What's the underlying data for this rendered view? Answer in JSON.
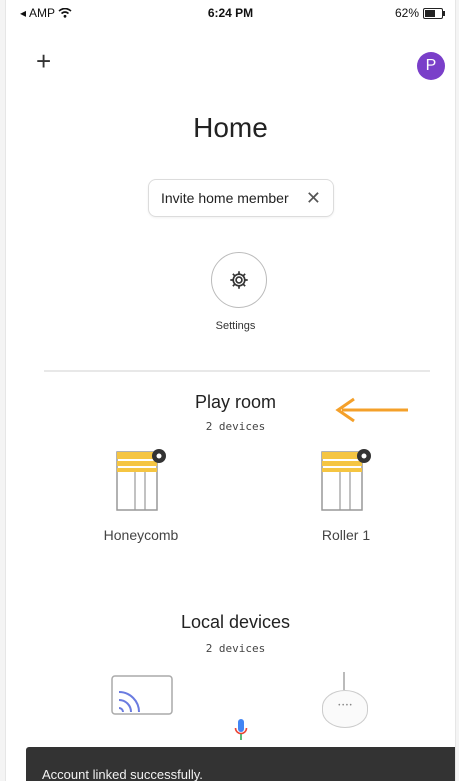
{
  "status_bar": {
    "carrier": "AMP",
    "time": "6:24 PM",
    "battery": "62%"
  },
  "header": {
    "avatar_letter": "P",
    "title": "Home"
  },
  "invite_chip": {
    "label": "Invite home member"
  },
  "settings": {
    "label": "Settings"
  },
  "room": {
    "title": "Play room",
    "count": "2 devices",
    "devices": [
      {
        "label": "Honeycomb",
        "icon": "blind-settings-icon"
      },
      {
        "label": "Roller 1",
        "icon": "blind-settings-icon"
      }
    ]
  },
  "local": {
    "title": "Local devices",
    "count": "2 devices"
  },
  "toast": {
    "message": "Account linked successfully."
  },
  "colors": {
    "avatar": "#7a3fc9",
    "arrow": "#f4a02a",
    "blind_yellow": "#f5c542",
    "mic_blue": "#4285f4"
  }
}
